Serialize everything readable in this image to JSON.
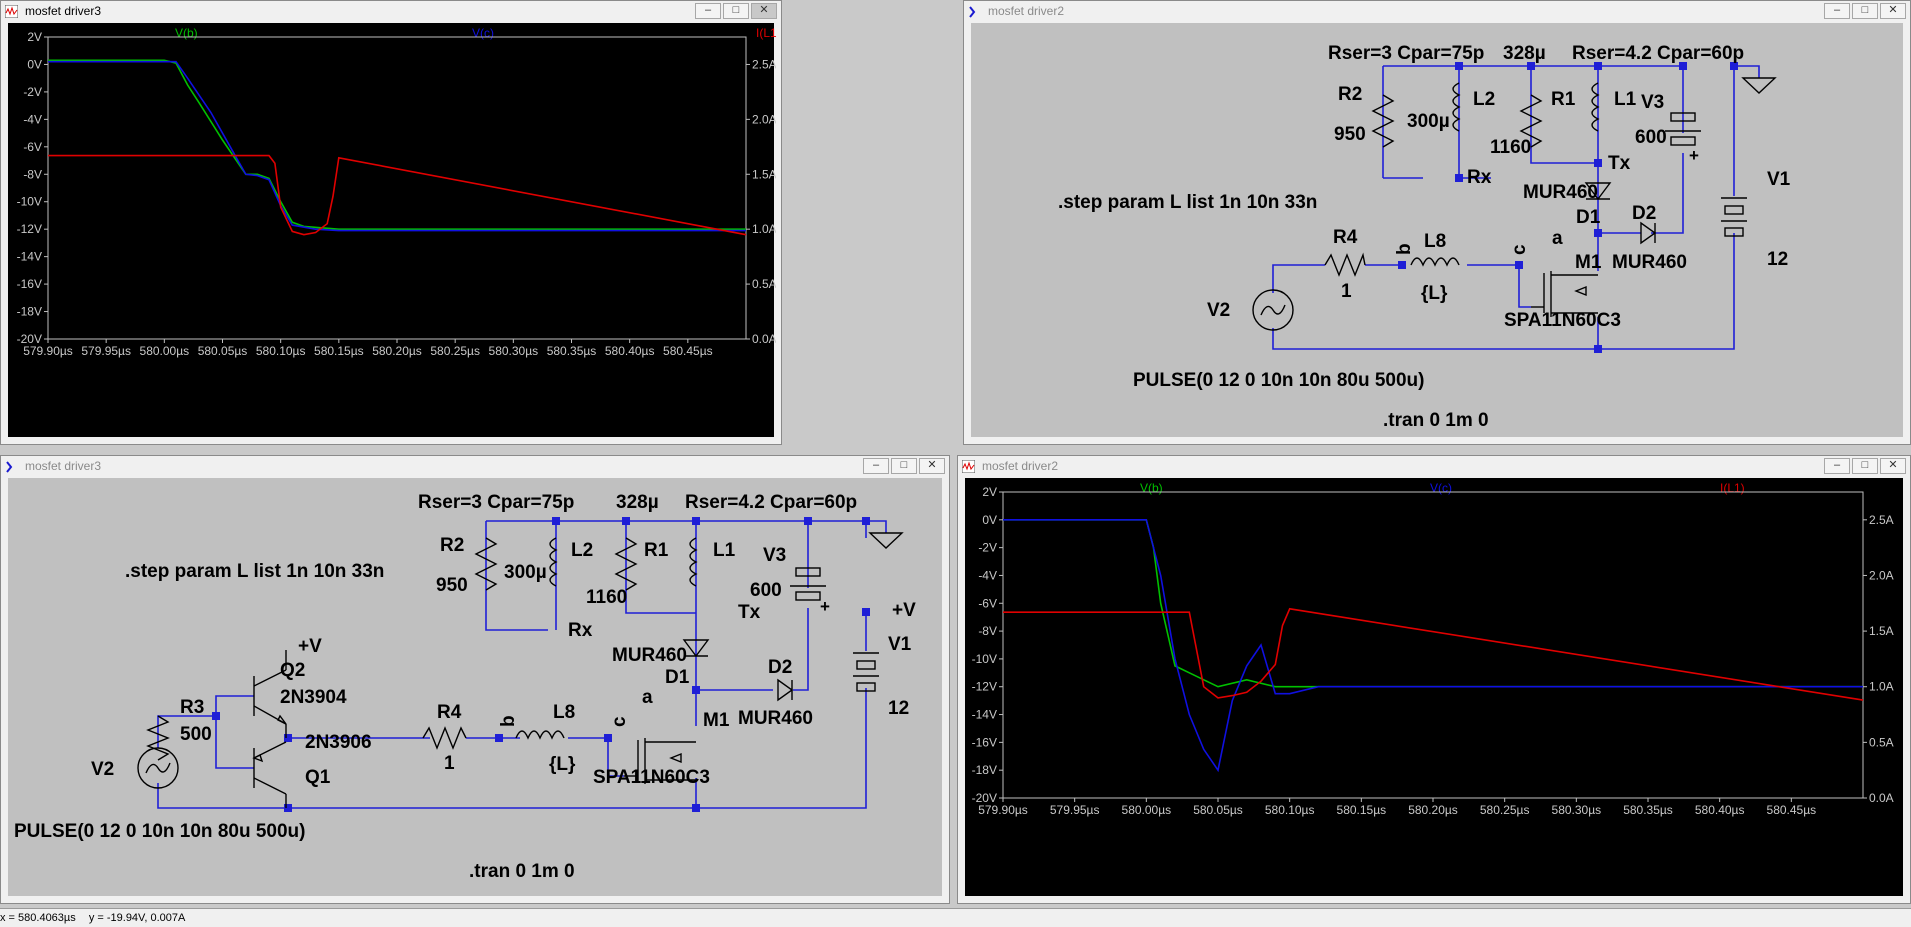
{
  "windows": {
    "top_left": {
      "title": "mosfet driver3",
      "active": true
    },
    "top_right": {
      "title": "mosfet driver2",
      "active": false
    },
    "bottom_left": {
      "title": "mosfet driver3",
      "active": false
    },
    "bottom_right": {
      "title": "mosfet driver2",
      "active": false
    }
  },
  "window_buttons": {
    "minimize": "–",
    "maximize": "□",
    "close": "✕"
  },
  "plot_top": {
    "traces": {
      "vb": "V(b)",
      "vc": "V(c)",
      "il1": "I(L1)"
    },
    "left_ticks": [
      "2V",
      "0V",
      "-2V",
      "-4V",
      "-6V",
      "-8V",
      "-10V",
      "-12V",
      "-14V",
      "-16V",
      "-18V",
      "-20V"
    ],
    "right_ticks": [
      "2.5A",
      "2.0A",
      "1.5A",
      "1.0A",
      "0.5A",
      "0.0A"
    ],
    "x_ticks": [
      "579.90µs",
      "579.95µs",
      "580.00µs",
      "580.05µs",
      "580.10µs",
      "580.15µs",
      "580.20µs",
      "580.25µs",
      "580.30µs",
      "580.35µs",
      "580.40µs",
      "580.45µs"
    ]
  },
  "plot_bottom": {
    "traces": {
      "vb": "V(b)",
      "vc": "V(c)",
      "il1": "I(L1)"
    },
    "left_ticks": [
      "2V",
      "0V",
      "-2V",
      "-4V",
      "-6V",
      "-8V",
      "-10V",
      "-12V",
      "-14V",
      "-16V",
      "-18V",
      "-20V"
    ],
    "right_ticks": [
      "2.5A",
      "2.0A",
      "1.5A",
      "1.0A",
      "0.5A",
      "0.0A"
    ],
    "x_ticks": [
      "579.90µs",
      "579.95µs",
      "580.00µs",
      "580.05µs",
      "580.10µs",
      "580.15µs",
      "580.20µs",
      "580.25µs",
      "580.30µs",
      "580.35µs",
      "580.40µs",
      "580.45µs"
    ]
  },
  "chart_data": [
    {
      "type": "line",
      "title": "",
      "x_unit": "µs",
      "xlim": [
        579.9,
        580.5
      ],
      "ylim_left": [
        -20,
        2
      ],
      "ylim_right": [
        0.0,
        2.75
      ],
      "series": [
        {
          "name": "V(b)",
          "color": "#00c000",
          "axis": "left",
          "x": [
            579.9,
            580.0,
            580.01,
            580.02,
            580.03,
            580.05,
            580.07,
            580.08,
            580.09,
            580.1,
            580.11,
            580.12,
            580.15,
            580.5
          ],
          "y": [
            0.3,
            0.3,
            0.1,
            -1.5,
            -2.8,
            -5.5,
            -8.0,
            -8.0,
            -8.3,
            -10.0,
            -11.5,
            -11.8,
            -12.0,
            -12.0
          ]
        },
        {
          "name": "V(c)",
          "color": "#1010e0",
          "axis": "left",
          "x": [
            579.9,
            580.01,
            580.02,
            580.04,
            580.06,
            580.07,
            580.08,
            580.09,
            580.1,
            580.11,
            580.13,
            580.15,
            580.5
          ],
          "y": [
            0.2,
            0.2,
            -1.0,
            -3.5,
            -6.5,
            -8.0,
            -8.1,
            -8.4,
            -10.3,
            -11.7,
            -12.0,
            -12.1,
            -12.1
          ]
        },
        {
          "name": "I(L1)",
          "color": "#e00000",
          "axis": "right",
          "x": [
            579.9,
            580.09,
            580.095,
            580.1,
            580.11,
            580.12,
            580.13,
            580.14,
            580.145,
            580.15,
            580.5
          ],
          "y": [
            1.67,
            1.67,
            1.6,
            1.2,
            0.98,
            0.95,
            0.97,
            1.05,
            1.3,
            1.65,
            0.95
          ]
        }
      ]
    },
    {
      "type": "line",
      "title": "",
      "x_unit": "µs",
      "xlim": [
        579.9,
        580.5
      ],
      "ylim_left": [
        -20,
        2
      ],
      "ylim_right": [
        0.0,
        2.75
      ],
      "series": [
        {
          "name": "V(b)",
          "color": "#00c000",
          "axis": "left",
          "x": [
            579.9,
            580.0,
            580.005,
            580.01,
            580.02,
            580.03,
            580.05,
            580.07,
            580.09,
            580.12,
            580.5
          ],
          "y": [
            0.0,
            0.0,
            -2.0,
            -6.0,
            -10.5,
            -11.0,
            -12.0,
            -11.5,
            -12.0,
            -12.0,
            -12.0
          ]
        },
        {
          "name": "V(c)",
          "color": "#1010e0",
          "axis": "left",
          "x": [
            579.9,
            580.0,
            580.01,
            580.02,
            580.03,
            580.04,
            580.05,
            580.06,
            580.07,
            580.08,
            580.09,
            580.1,
            580.12,
            580.5
          ],
          "y": [
            0.0,
            0.0,
            -4.0,
            -10.0,
            -14.0,
            -16.5,
            -18.0,
            -13.0,
            -10.5,
            -9.0,
            -12.5,
            -12.5,
            -12.0,
            -12.0
          ]
        },
        {
          "name": "I(L1)",
          "color": "#e00000",
          "axis": "right",
          "x": [
            579.9,
            580.03,
            580.04,
            580.05,
            580.06,
            580.07,
            580.08,
            580.09,
            580.095,
            580.1,
            580.5
          ],
          "y": [
            1.67,
            1.67,
            1.0,
            0.9,
            0.92,
            0.95,
            1.05,
            1.2,
            1.55,
            1.7,
            0.88
          ]
        }
      ]
    }
  ],
  "schematic_top": {
    "labels": {
      "rser1": "Rser=3 Cpar=75p",
      "l1_val": "328µ",
      "rser2": "Rser=4.2 Cpar=60p",
      "r2": "R2",
      "r2_val": "950",
      "l2_val": "300µ",
      "l2": "L2",
      "r1": "R1",
      "r1_val": "1160",
      "l1": "L1",
      "v3": "V3",
      "v3_val": "600",
      "v1": "V1",
      "v1_val": "12",
      "rx": "Rx",
      "tx": "Tx",
      "step": ".step param L list 1n 10n 33n",
      "mur1": "MUR460",
      "d1": "D1",
      "d2": "D2",
      "mur2": "MUR460",
      "a": "a",
      "r4": "R4",
      "r4_val": "1",
      "b": "b",
      "l8": "L8",
      "l8_val": "{L}",
      "c": "c",
      "m1": "M1",
      "v2": "V2",
      "mosfet": "SPA11N60C3",
      "pulse": "PULSE(0 12 0 10n 10n 80u 500u)",
      "tran": ".tran 0 1m 0"
    }
  },
  "schematic_bottom": {
    "labels": {
      "rser1": "Rser=3 Cpar=75p",
      "l1_val": "328µ",
      "rser2": "Rser=4.2 Cpar=60p",
      "r2": "R2",
      "r2_val": "950",
      "l2_val": "300µ",
      "l2": "L2",
      "r1": "R1",
      "r1_val": "1160",
      "l1": "L1",
      "v3": "V3",
      "v3_val": "600",
      "v1": "V1",
      "v1_val": "12",
      "rx": "Rx",
      "tx": "Tx",
      "step": ".step param L list 1n 10n 33n",
      "mur1": "MUR460",
      "d1": "D1",
      "d2": "D2",
      "mur2": "MUR460",
      "a": "a",
      "r4": "R4",
      "r4_val": "1",
      "b": "b",
      "l8": "L8",
      "l8_val": "{L}",
      "c": "c",
      "m1": "M1",
      "v2": "V2",
      "mosfet": "SPA11N60C3",
      "pulse": "PULSE(0 12 0 10n 10n 80u 500u)",
      "tran": ".tran 0 1m 0",
      "plus_v1": "+V",
      "plus_v2": "+V",
      "q2": "Q2",
      "q2_model": "2N3904",
      "q1": "Q1",
      "q1_model": "2N3906",
      "r3": "R3",
      "r3_val": "500"
    }
  },
  "status": {
    "x": "x = 580.4063µs",
    "y": "y = -19.94V, 0.007A"
  }
}
